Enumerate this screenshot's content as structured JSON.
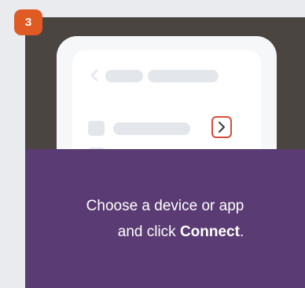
{
  "step": {
    "number": "3"
  },
  "caption": {
    "line1": "Choose a device or app",
    "line2_prefix": "and click ",
    "line2_bold": "Connect",
    "line2_suffix": "."
  },
  "colors": {
    "badge": "#e05a24",
    "card": "#5a3b73",
    "illustration_bg": "#4b4542",
    "highlight": "#d94b3a"
  },
  "icons": {
    "back": "chevron-left-icon",
    "connect": "chevron-right-icon",
    "next": "chevron-right-icon"
  }
}
